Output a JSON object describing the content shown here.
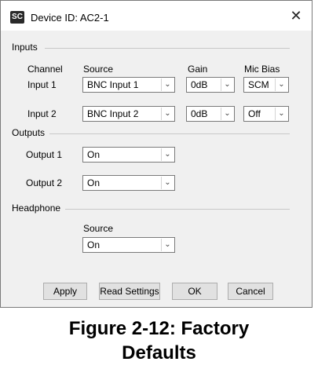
{
  "window": {
    "title": "Device ID: AC2-1",
    "app_icon_text": "SC",
    "close_glyph": "✕"
  },
  "inputs": {
    "group_label": "Inputs",
    "columns": {
      "channel": "Channel",
      "source": "Source",
      "gain": "Gain",
      "mic_bias": "Mic Bias"
    },
    "rows": [
      {
        "label": "Input 1",
        "source": "BNC Input 1",
        "gain": "0dB",
        "mic_bias": "SCM"
      },
      {
        "label": "Input 2",
        "source": "BNC Input 2",
        "gain": "0dB",
        "mic_bias": "Off"
      }
    ]
  },
  "outputs": {
    "group_label": "Outputs",
    "rows": [
      {
        "label": "Output 1",
        "value": "On"
      },
      {
        "label": "Output 2",
        "value": "On"
      }
    ]
  },
  "headphone": {
    "group_label": "Headphone",
    "source_label": "Source",
    "source_value": "On"
  },
  "buttons": {
    "apply": "Apply",
    "read_settings": "Read Settings",
    "ok": "OK",
    "cancel": "Cancel"
  },
  "caption": {
    "line1": "Figure  2-12:  Factory",
    "line2": "Defaults"
  }
}
